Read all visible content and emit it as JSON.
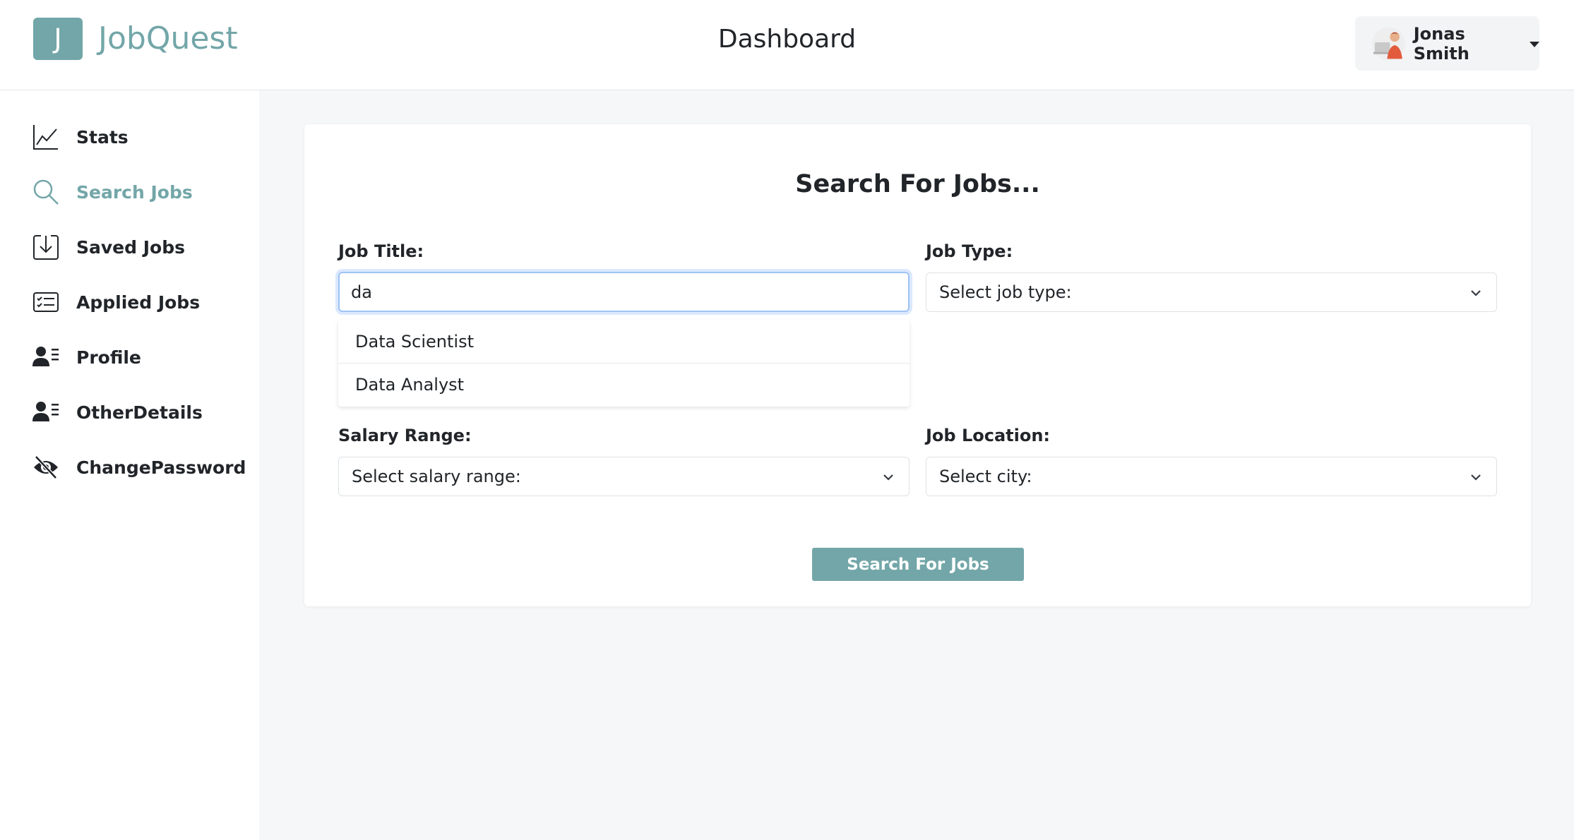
{
  "brand": {
    "logo_letter": "J",
    "name": "JobQuest"
  },
  "header": {
    "title": "Dashboard",
    "user_name": "Jonas Smith"
  },
  "sidebar": {
    "active": "Search Jobs",
    "items": [
      {
        "label": "Stats",
        "icon": "chart-line-icon"
      },
      {
        "label": "Search Jobs",
        "icon": "search-icon"
      },
      {
        "label": "Saved Jobs",
        "icon": "download-box-icon"
      },
      {
        "label": "Applied Jobs",
        "icon": "checklist-card-icon"
      },
      {
        "label": "Profile",
        "icon": "user-list-icon"
      },
      {
        "label": "OtherDetails",
        "icon": "user-list-icon"
      },
      {
        "label": "ChangePassword",
        "icon": "eye-slash-icon"
      }
    ]
  },
  "search": {
    "heading": "Search For Jobs...",
    "job_title": {
      "label": "Job Title:",
      "value": "da"
    },
    "suggestions": [
      "Data Scientist",
      "Data Analyst"
    ],
    "job_type": {
      "label": "Job Type:",
      "selected": "Select job type:"
    },
    "salary_range": {
      "label": "Salary Range:",
      "selected": "Select salary range:"
    },
    "job_location": {
      "label": "Job Location:",
      "selected": "Select city:"
    },
    "button_label": "Search For Jobs"
  },
  "colors": {
    "accent": "#73a6a8",
    "focus_border": "#9ec3f4",
    "background": "#f6f7f8"
  }
}
